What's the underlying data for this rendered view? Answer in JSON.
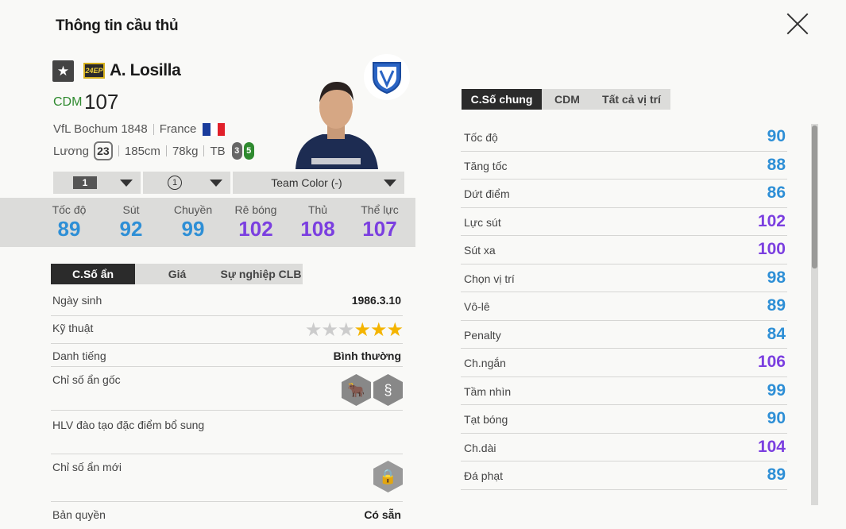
{
  "header": {
    "title": "Thông tin cầu thủ"
  },
  "player": {
    "season_badge": "24EP",
    "name": "A. Losilla",
    "position": "CDM",
    "ovr": "107",
    "club": "VfL Bochum 1848",
    "nation": "France",
    "salary_label": "Lương",
    "salary": "23",
    "height": "185cm",
    "weight": "78kg",
    "body": "TB",
    "foot_left": "3",
    "foot_right": "5"
  },
  "dropdowns": {
    "level": "1",
    "rank": "1",
    "team_color": "Team Color (-)"
  },
  "summary_stats": [
    {
      "label": "Tốc độ",
      "value": "89",
      "color": "#2e8fd6"
    },
    {
      "label": "Sút",
      "value": "92",
      "color": "#2e8fd6"
    },
    {
      "label": "Chuyền",
      "value": "99",
      "color": "#2e8fd6"
    },
    {
      "label": "Rê bóng",
      "value": "102",
      "color": "#7b3fe0"
    },
    {
      "label": "Thủ",
      "value": "108",
      "color": "#7b3fe0"
    },
    {
      "label": "Thể lực",
      "value": "107",
      "color": "#7b3fe0"
    }
  ],
  "left_tabs": [
    "C.Số ẩn",
    "Giá",
    "Sự nghiệp CLB"
  ],
  "details": {
    "birth_label": "Ngày sinh",
    "birth": "1986.3.10",
    "skill_label": "Kỹ thuật",
    "skill_stars": 3,
    "fame_label": "Danh tiếng",
    "fame": "Bình thường",
    "hidden_label": "Chỉ số ẩn gốc",
    "coach_label": "HLV đào tạo đặc điểm bổ sung",
    "new_hidden_label": "Chỉ số ẩn mới",
    "license_label": "Bản quyền",
    "license": "Có sẵn"
  },
  "right_tabs": [
    "C.Số chung",
    "CDM",
    "Tất cả vị trí"
  ],
  "attributes": [
    {
      "label": "Tốc độ",
      "value": "90",
      "color": "#2e8fd6"
    },
    {
      "label": "Tăng tốc",
      "value": "88",
      "color": "#2e8fd6"
    },
    {
      "label": "Dứt điểm",
      "value": "86",
      "color": "#2e8fd6"
    },
    {
      "label": "Lực sút",
      "value": "102",
      "color": "#7b3fe0"
    },
    {
      "label": "Sút xa",
      "value": "100",
      "color": "#7b3fe0"
    },
    {
      "label": "Chọn vị trí",
      "value": "98",
      "color": "#2e8fd6"
    },
    {
      "label": "Vô-lê",
      "value": "89",
      "color": "#2e8fd6"
    },
    {
      "label": "Penalty",
      "value": "84",
      "color": "#2e8fd6"
    },
    {
      "label": "Ch.ngắn",
      "value": "106",
      "color": "#7b3fe0"
    },
    {
      "label": "Tầm nhìn",
      "value": "99",
      "color": "#2e8fd6"
    },
    {
      "label": "Tạt bóng",
      "value": "90",
      "color": "#2e8fd6"
    },
    {
      "label": "Ch.dài",
      "value": "104",
      "color": "#7b3fe0"
    },
    {
      "label": "Đá phạt",
      "value": "89",
      "color": "#2e8fd6"
    }
  ],
  "colors": {
    "accent_blue": "#2e8fd6",
    "accent_purple": "#7b3fe0",
    "star": "#f4b400",
    "position_green": "#2f8a2f"
  }
}
